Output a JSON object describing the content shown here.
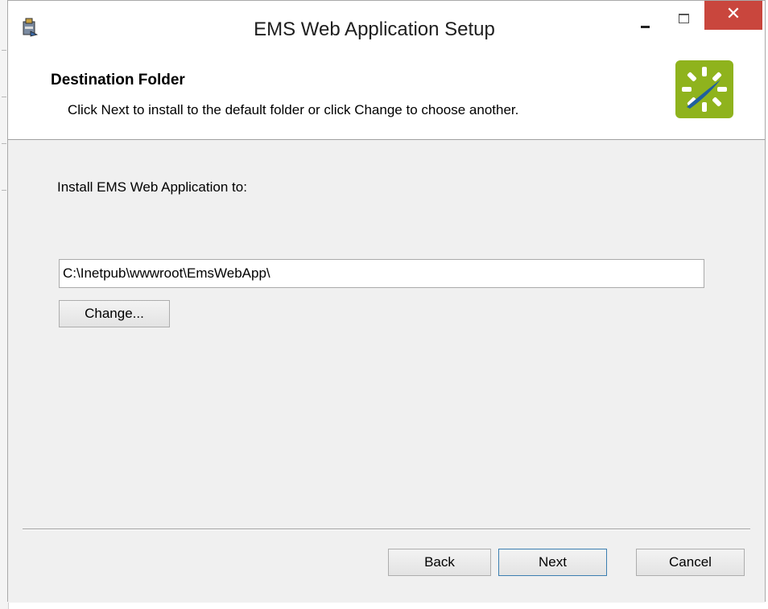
{
  "window": {
    "title": "EMS Web Application Setup",
    "close_glyph": "✕"
  },
  "header": {
    "title": "Destination Folder",
    "description": "Click Next to install to the default folder or click Change to choose another."
  },
  "body": {
    "install_label": "Install EMS Web Application to:",
    "path_value": "C:\\Inetpub\\wwwroot\\EmsWebApp\\",
    "change_label": "Change..."
  },
  "footer": {
    "back_label": "Back",
    "next_label": "Next",
    "cancel_label": "Cancel"
  },
  "colors": {
    "logo_bg": "#8fb31d",
    "close_bg": "#c9463d",
    "focus_border": "#3c7fb1"
  },
  "icons": {
    "app": "installer-icon",
    "logo": "ems-logo-icon"
  }
}
